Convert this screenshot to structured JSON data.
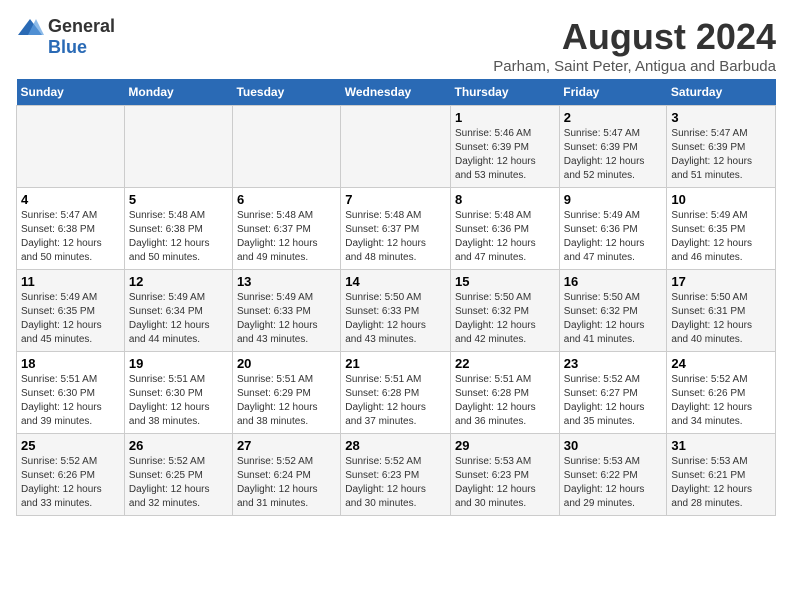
{
  "logo": {
    "general": "General",
    "blue": "Blue"
  },
  "header": {
    "month": "August 2024",
    "location": "Parham, Saint Peter, Antigua and Barbuda"
  },
  "weekdays": [
    "Sunday",
    "Monday",
    "Tuesday",
    "Wednesday",
    "Thursday",
    "Friday",
    "Saturday"
  ],
  "weeks": [
    [
      {
        "day": "",
        "info": ""
      },
      {
        "day": "",
        "info": ""
      },
      {
        "day": "",
        "info": ""
      },
      {
        "day": "",
        "info": ""
      },
      {
        "day": "1",
        "info": "Sunrise: 5:46 AM\nSunset: 6:39 PM\nDaylight: 12 hours\nand 53 minutes."
      },
      {
        "day": "2",
        "info": "Sunrise: 5:47 AM\nSunset: 6:39 PM\nDaylight: 12 hours\nand 52 minutes."
      },
      {
        "day": "3",
        "info": "Sunrise: 5:47 AM\nSunset: 6:39 PM\nDaylight: 12 hours\nand 51 minutes."
      }
    ],
    [
      {
        "day": "4",
        "info": "Sunrise: 5:47 AM\nSunset: 6:38 PM\nDaylight: 12 hours\nand 50 minutes."
      },
      {
        "day": "5",
        "info": "Sunrise: 5:48 AM\nSunset: 6:38 PM\nDaylight: 12 hours\nand 50 minutes."
      },
      {
        "day": "6",
        "info": "Sunrise: 5:48 AM\nSunset: 6:37 PM\nDaylight: 12 hours\nand 49 minutes."
      },
      {
        "day": "7",
        "info": "Sunrise: 5:48 AM\nSunset: 6:37 PM\nDaylight: 12 hours\nand 48 minutes."
      },
      {
        "day": "8",
        "info": "Sunrise: 5:48 AM\nSunset: 6:36 PM\nDaylight: 12 hours\nand 47 minutes."
      },
      {
        "day": "9",
        "info": "Sunrise: 5:49 AM\nSunset: 6:36 PM\nDaylight: 12 hours\nand 47 minutes."
      },
      {
        "day": "10",
        "info": "Sunrise: 5:49 AM\nSunset: 6:35 PM\nDaylight: 12 hours\nand 46 minutes."
      }
    ],
    [
      {
        "day": "11",
        "info": "Sunrise: 5:49 AM\nSunset: 6:35 PM\nDaylight: 12 hours\nand 45 minutes."
      },
      {
        "day": "12",
        "info": "Sunrise: 5:49 AM\nSunset: 6:34 PM\nDaylight: 12 hours\nand 44 minutes."
      },
      {
        "day": "13",
        "info": "Sunrise: 5:49 AM\nSunset: 6:33 PM\nDaylight: 12 hours\nand 43 minutes."
      },
      {
        "day": "14",
        "info": "Sunrise: 5:50 AM\nSunset: 6:33 PM\nDaylight: 12 hours\nand 43 minutes."
      },
      {
        "day": "15",
        "info": "Sunrise: 5:50 AM\nSunset: 6:32 PM\nDaylight: 12 hours\nand 42 minutes."
      },
      {
        "day": "16",
        "info": "Sunrise: 5:50 AM\nSunset: 6:32 PM\nDaylight: 12 hours\nand 41 minutes."
      },
      {
        "day": "17",
        "info": "Sunrise: 5:50 AM\nSunset: 6:31 PM\nDaylight: 12 hours\nand 40 minutes."
      }
    ],
    [
      {
        "day": "18",
        "info": "Sunrise: 5:51 AM\nSunset: 6:30 PM\nDaylight: 12 hours\nand 39 minutes."
      },
      {
        "day": "19",
        "info": "Sunrise: 5:51 AM\nSunset: 6:30 PM\nDaylight: 12 hours\nand 38 minutes."
      },
      {
        "day": "20",
        "info": "Sunrise: 5:51 AM\nSunset: 6:29 PM\nDaylight: 12 hours\nand 38 minutes."
      },
      {
        "day": "21",
        "info": "Sunrise: 5:51 AM\nSunset: 6:28 PM\nDaylight: 12 hours\nand 37 minutes."
      },
      {
        "day": "22",
        "info": "Sunrise: 5:51 AM\nSunset: 6:28 PM\nDaylight: 12 hours\nand 36 minutes."
      },
      {
        "day": "23",
        "info": "Sunrise: 5:52 AM\nSunset: 6:27 PM\nDaylight: 12 hours\nand 35 minutes."
      },
      {
        "day": "24",
        "info": "Sunrise: 5:52 AM\nSunset: 6:26 PM\nDaylight: 12 hours\nand 34 minutes."
      }
    ],
    [
      {
        "day": "25",
        "info": "Sunrise: 5:52 AM\nSunset: 6:26 PM\nDaylight: 12 hours\nand 33 minutes."
      },
      {
        "day": "26",
        "info": "Sunrise: 5:52 AM\nSunset: 6:25 PM\nDaylight: 12 hours\nand 32 minutes."
      },
      {
        "day": "27",
        "info": "Sunrise: 5:52 AM\nSunset: 6:24 PM\nDaylight: 12 hours\nand 31 minutes."
      },
      {
        "day": "28",
        "info": "Sunrise: 5:52 AM\nSunset: 6:23 PM\nDaylight: 12 hours\nand 30 minutes."
      },
      {
        "day": "29",
        "info": "Sunrise: 5:53 AM\nSunset: 6:23 PM\nDaylight: 12 hours\nand 30 minutes."
      },
      {
        "day": "30",
        "info": "Sunrise: 5:53 AM\nSunset: 6:22 PM\nDaylight: 12 hours\nand 29 minutes."
      },
      {
        "day": "31",
        "info": "Sunrise: 5:53 AM\nSunset: 6:21 PM\nDaylight: 12 hours\nand 28 minutes."
      }
    ]
  ]
}
